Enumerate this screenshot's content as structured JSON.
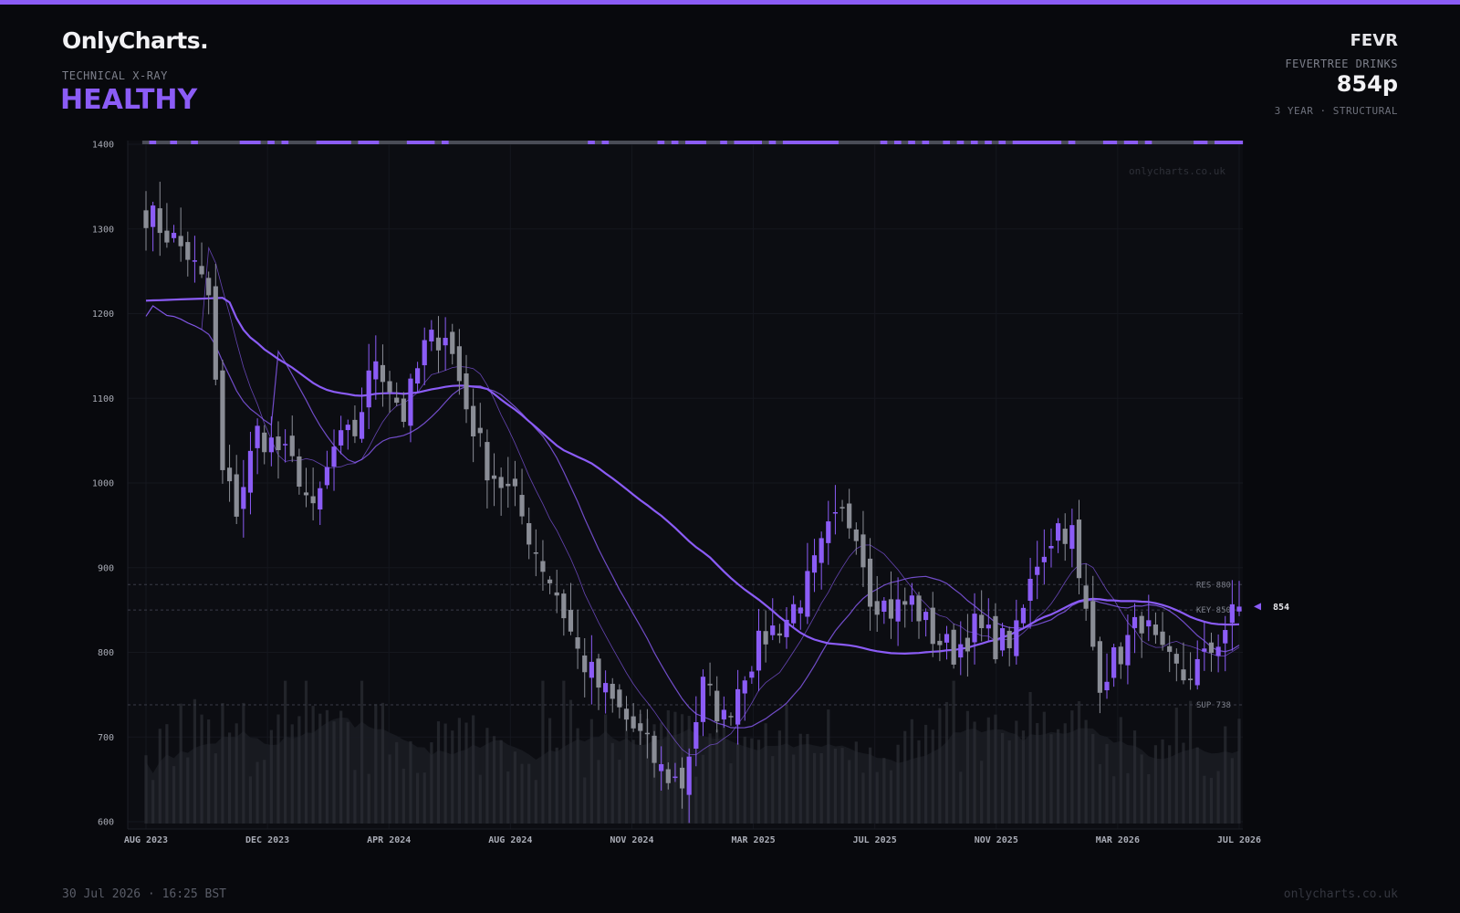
{
  "header": {
    "brand": "OnlyCharts.",
    "report_label": "TECHNICAL X-RAY",
    "status": "HEALTHY",
    "ticker": "FEVR",
    "company": "FEVERTREE DRINKS",
    "price": "854p",
    "timeframe": "3 YEAR · STRUCTURAL"
  },
  "footer": {
    "timestamp": "30 Jul 2026 · 16:25 BST",
    "site": "onlycharts.co.uk"
  },
  "colors": {
    "accent": "#8b5cf6",
    "up_candle": "#8b5cf6",
    "down_candle": "#8a8d96",
    "background": "#08090d",
    "plot_background": "#0c0d12",
    "volume": "#2a2c33"
  },
  "chart_data": {
    "type": "candlestick",
    "title": "",
    "xlabel": "",
    "ylabel": "",
    "ylim": [
      600,
      1400
    ],
    "y_ticks": [
      "600",
      "700",
      "800",
      "900",
      "1000",
      "1100",
      "1200",
      "1300",
      "1400"
    ],
    "x_ticks": [
      "AUG 2023",
      "DEC 2023",
      "APR 2024",
      "AUG 2024",
      "NOV 2024",
      "MAR 2025",
      "JUL 2025",
      "NOV 2025",
      "MAR 2026",
      "JUL 2026"
    ],
    "grid": true,
    "watermark": "onlycharts.co.uk",
    "price_anchors": [
      [
        0,
        1320
      ],
      [
        6,
        1270
      ],
      [
        9,
        1220
      ],
      [
        11,
        1010
      ],
      [
        13,
        970
      ],
      [
        16,
        1060
      ],
      [
        19,
        1040
      ],
      [
        22,
        1010
      ],
      [
        24,
        960
      ],
      [
        27,
        1040
      ],
      [
        30,
        1060
      ],
      [
        33,
        1150
      ],
      [
        37,
        1080
      ],
      [
        40,
        1160
      ],
      [
        43,
        1180
      ],
      [
        46,
        1090
      ],
      [
        49,
        1020
      ],
      [
        53,
        980
      ],
      [
        56,
        920
      ],
      [
        59,
        870
      ],
      [
        62,
        800
      ],
      [
        65,
        760
      ],
      [
        68,
        730
      ],
      [
        71,
        700
      ],
      [
        74,
        660
      ],
      [
        77,
        645
      ],
      [
        80,
        760
      ],
      [
        83,
        720
      ],
      [
        86,
        780
      ],
      [
        89,
        820
      ],
      [
        92,
        840
      ],
      [
        95,
        880
      ],
      [
        98,
        940
      ],
      [
        100,
        960
      ],
      [
        102,
        950
      ],
      [
        104,
        870
      ],
      [
        107,
        850
      ],
      [
        110,
        860
      ],
      [
        113,
        820
      ],
      [
        116,
        800
      ],
      [
        119,
        830
      ],
      [
        122,
        810
      ],
      [
        125,
        820
      ],
      [
        128,
        910
      ],
      [
        131,
        950
      ],
      [
        133,
        940
      ],
      [
        134,
        880
      ],
      [
        137,
        770
      ],
      [
        140,
        800
      ],
      [
        143,
        840
      ],
      [
        146,
        790
      ],
      [
        149,
        770
      ],
      [
        152,
        790
      ],
      [
        155,
        830
      ],
      [
        157,
        854
      ]
    ],
    "candle_count": 158,
    "volume_note": "relative volume bars with shaded rolling average at bottom of plot",
    "moving_averages": [
      {
        "window": 10,
        "weight": "thin"
      },
      {
        "window": 20,
        "weight": "medium"
      },
      {
        "window": 50,
        "weight": "thick"
      }
    ],
    "levels": [
      {
        "label": "RES",
        "value": 880
      },
      {
        "label": "KEY",
        "value": 850
      },
      {
        "label": "SUP",
        "value": 738
      }
    ],
    "last_price": 854,
    "last_price_label": "854"
  }
}
